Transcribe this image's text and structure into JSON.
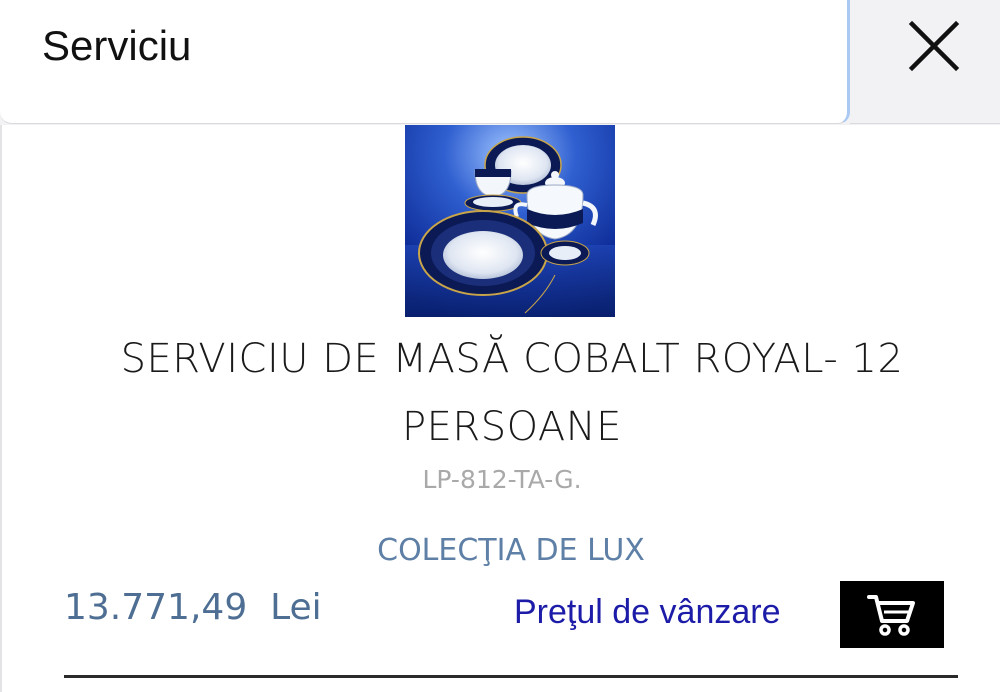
{
  "search": {
    "value": "Serviciu"
  },
  "close": {
    "icon": "close-icon"
  },
  "product": {
    "image_icon": "product-photo",
    "title": "SERVICIU DE MASĂ COBALT ROYAL- 12 PERSOANE",
    "code": "LP-812-TA-G.",
    "collection": "COLECŢIA DE LUX",
    "price": "13.771,49  Lei",
    "price_label": "Preţul de vânzare",
    "cart_icon": "shopping-cart-icon"
  },
  "colors": {
    "price": "#4e6f93",
    "price_label": "#1d1ca8",
    "collection": "#5e7fa6",
    "cart_button": "#000000"
  }
}
